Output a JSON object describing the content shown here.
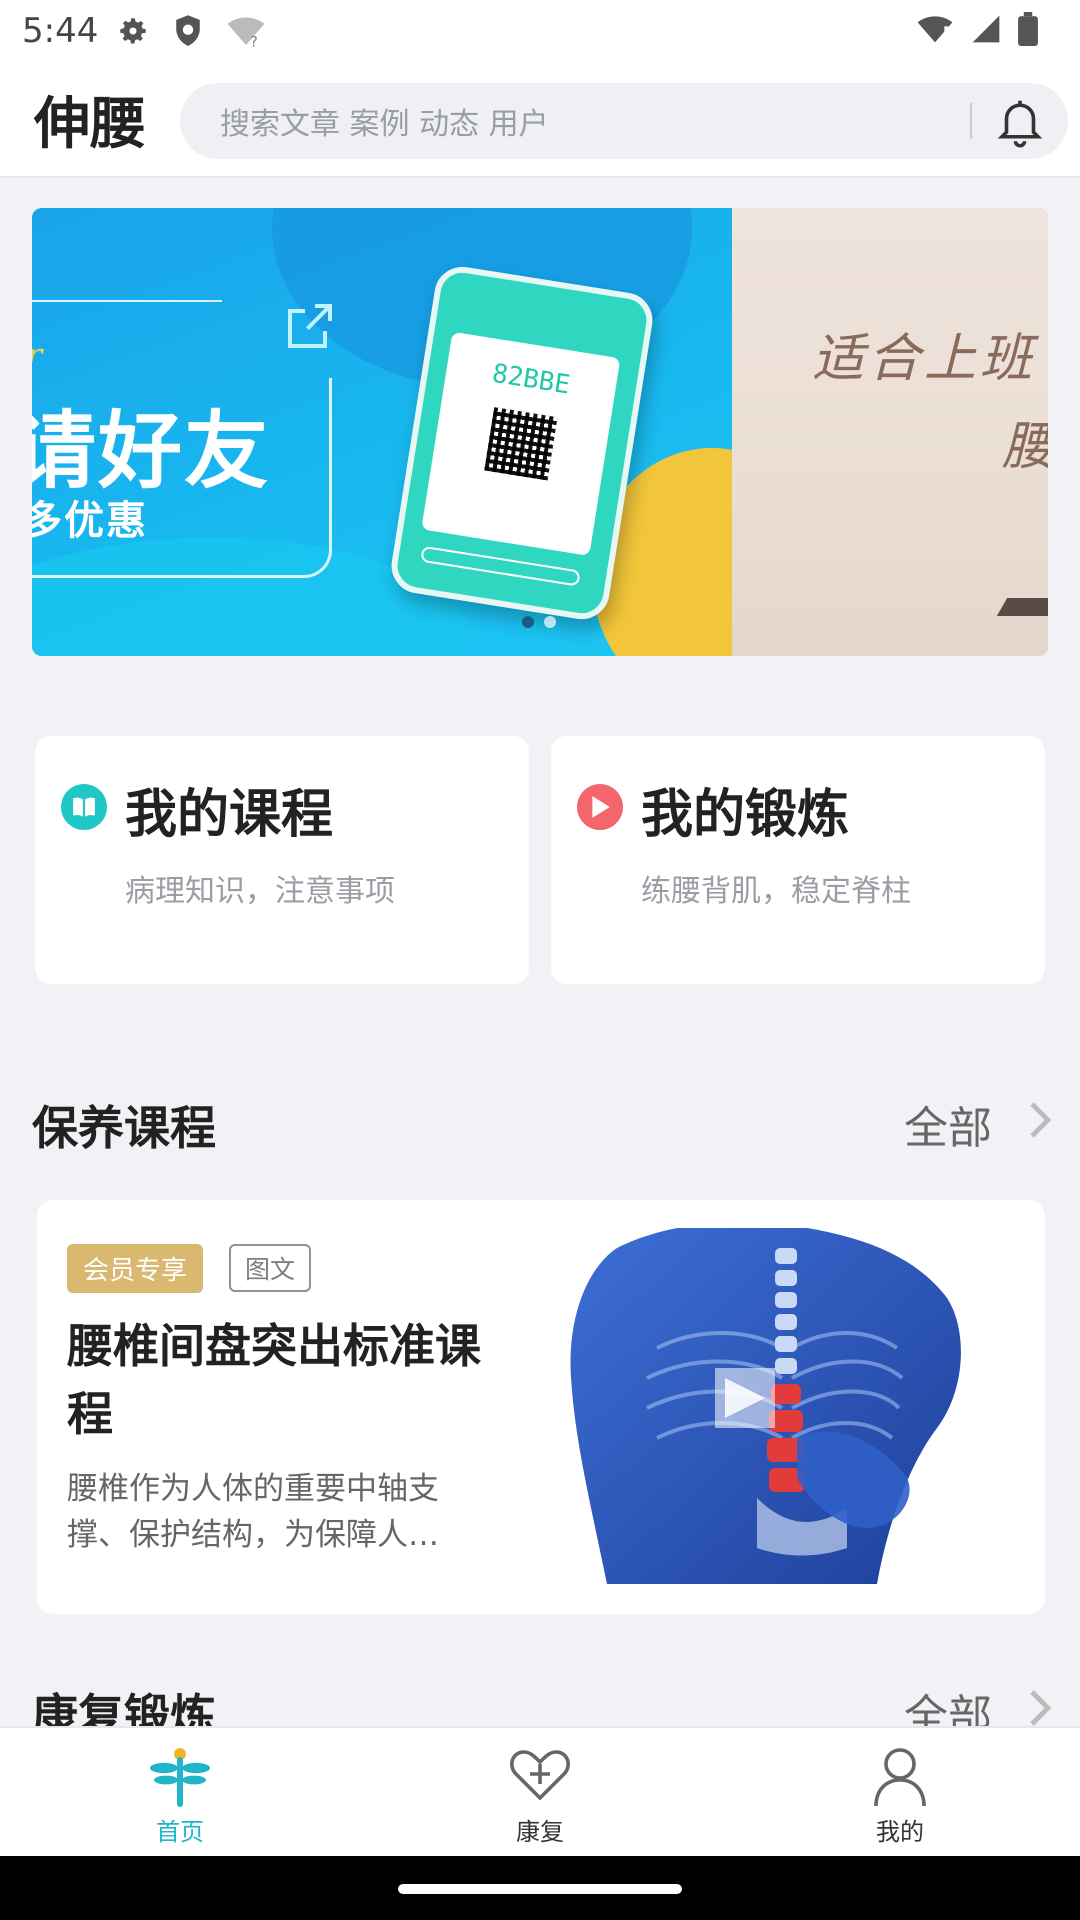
{
  "status_bar": {
    "time": "5:44"
  },
  "header": {
    "title": "伸腰",
    "search_placeholder": "搜索文章 案例 动态 用户"
  },
  "banner": {
    "slide1": {
      "script_text": "r",
      "headline": "请好友",
      "subline": "多优惠",
      "phone_code": "82BBE"
    },
    "slide2": {
      "line1": "适合上班",
      "line2": "腰"
    },
    "active_dot_index": 0
  },
  "quick_cards": [
    {
      "title": "我的课程",
      "subtitle": "病理知识，注意事项",
      "icon": "book-icon",
      "color": "#1fc8c7"
    },
    {
      "title": "我的锻炼",
      "subtitle": "练腰背肌，稳定脊柱",
      "icon": "play-icon",
      "color": "#f2666c"
    }
  ],
  "section_courses": {
    "title": "保养课程",
    "more": "全部"
  },
  "course": {
    "tag_vip": "会员专享",
    "tag_type": "图文",
    "title": "腰椎间盘突出标准课程",
    "description": "腰椎作为人体的重要中轴支撑、保护结构，为保障人…"
  },
  "section_rehab": {
    "title": "康复锻炼",
    "more": "全部"
  },
  "bottom_nav": [
    {
      "label": "首页",
      "icon": "dragonfly-home-icon",
      "active": true
    },
    {
      "label": "康复",
      "icon": "heart-plus-icon",
      "active": false
    },
    {
      "label": "我的",
      "icon": "person-icon",
      "active": false
    }
  ],
  "colors": {
    "accent": "#20b6c8",
    "vip_gold": "#d9b870",
    "background": "#f1f2f5"
  }
}
